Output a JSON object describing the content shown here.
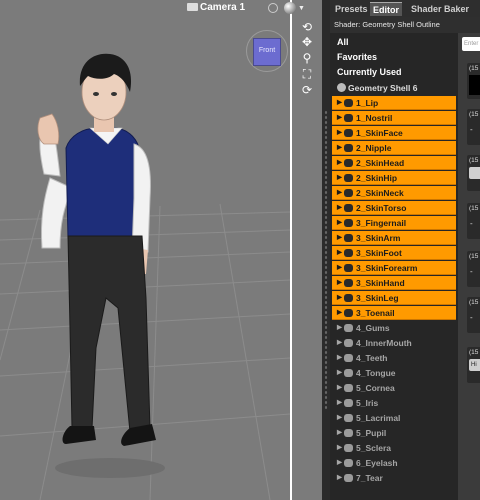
{
  "viewport": {
    "camera_label": "Camera 1",
    "cube_face_label": "Front"
  },
  "panel": {
    "tabs": [
      "Presets",
      "Editor",
      "Shader Baker"
    ],
    "active_tab": "Editor",
    "shader_title": "Shader: Geometry Shell Outline",
    "search_placeholder": "Enter",
    "categories": [
      "All",
      "Favorites",
      "Currently Used"
    ],
    "group": "Geometry Shell 6",
    "surfaces_selected": [
      "1_Lip",
      "1_Nostril",
      "1_SkinFace",
      "2_Nipple",
      "2_SkinHead",
      "2_SkinHip",
      "2_SkinNeck",
      "2_SkinTorso",
      "3_Fingernail",
      "3_SkinArm",
      "3_SkinFoot",
      "3_SkinForearm",
      "3_SkinHand",
      "3_SkinLeg",
      "3_Toenail"
    ],
    "surfaces_unselected": [
      "4_Gums",
      "4_InnerMouth",
      "4_Teeth",
      "4_Tongue",
      "5_Cornea",
      "5_Iris",
      "5_Lacrimal",
      "5_Pupil",
      "5_Sclera",
      "6_Eyelash",
      "7_Tear"
    ],
    "prop_tags": [
      "(15",
      "(15",
      "(15",
      "(15",
      "(15",
      "(15",
      "(15"
    ],
    "prop_button": "Hi"
  },
  "colors": {
    "selected": "#ff9a00",
    "viewport_bg": "#7b7b7b",
    "panel_bg": "#262626"
  }
}
